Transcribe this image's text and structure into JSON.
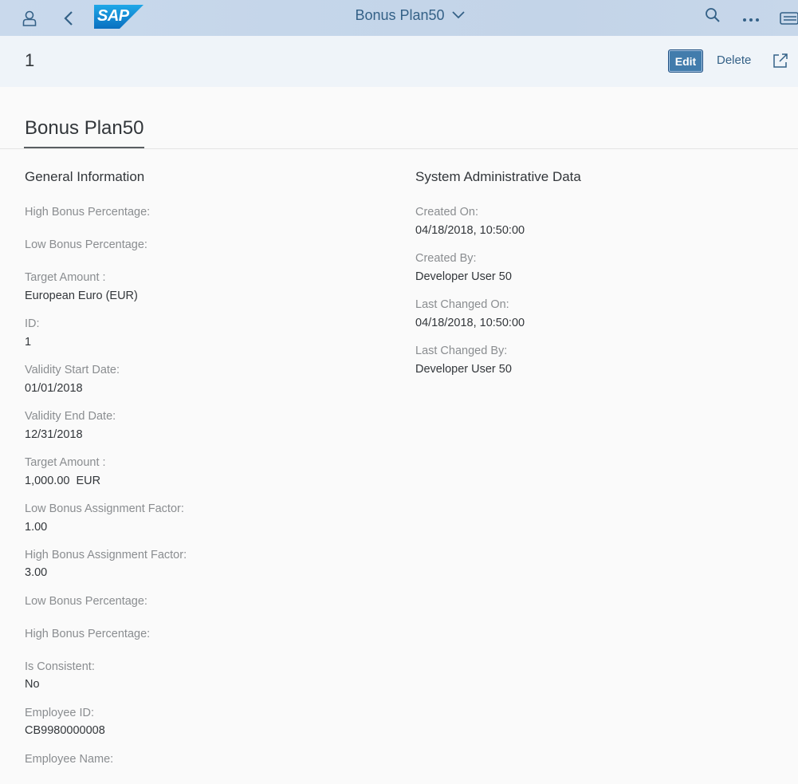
{
  "shell": {
    "logo_text": "SAP",
    "title": "Bonus Plan50",
    "icons": [
      "user-icon",
      "back-icon",
      "search-icon",
      "overflow-icon",
      "notifications-icon"
    ]
  },
  "header": {
    "object_id": "1",
    "edit_label": "Edit",
    "delete_label": "Delete"
  },
  "anchor_tab": "Bonus Plan50",
  "general": {
    "title": "General Information",
    "fields": [
      {
        "label": "High Bonus Percentage:",
        "value": ""
      },
      {
        "label": "Low Bonus Percentage:",
        "value": ""
      },
      {
        "label": "Target Amount :",
        "value": "European Euro (EUR)"
      },
      {
        "label": "ID:",
        "value": "1"
      },
      {
        "label": "Validity Start Date:",
        "value": "01/01/2018"
      },
      {
        "label": "Validity End Date:",
        "value": "12/31/2018"
      },
      {
        "label": "Target Amount :",
        "value": "1,000.00  EUR"
      },
      {
        "label": "Low Bonus Assignment Factor:",
        "value": "1.00"
      },
      {
        "label": "High Bonus Assignment Factor:",
        "value": "3.00"
      },
      {
        "label": "Low Bonus Percentage:",
        "value": ""
      },
      {
        "label": "High Bonus Percentage:",
        "value": ""
      },
      {
        "label": "Is Consistent:",
        "value": "No"
      },
      {
        "label": "Employee ID:",
        "value": "CB9980000008"
      },
      {
        "label": "Employee Name:",
        "value": ""
      }
    ]
  },
  "admin": {
    "title": "System Administrative Data",
    "fields": [
      {
        "label": "Created On:",
        "value": "04/18/2018, 10:50:00"
      },
      {
        "label": "Created By:",
        "value": "Developer User 50"
      },
      {
        "label": "Last Changed On:",
        "value": "04/18/2018, 10:50:00"
      },
      {
        "label": "Last Changed By:",
        "value": "Developer User 50"
      }
    ]
  }
}
